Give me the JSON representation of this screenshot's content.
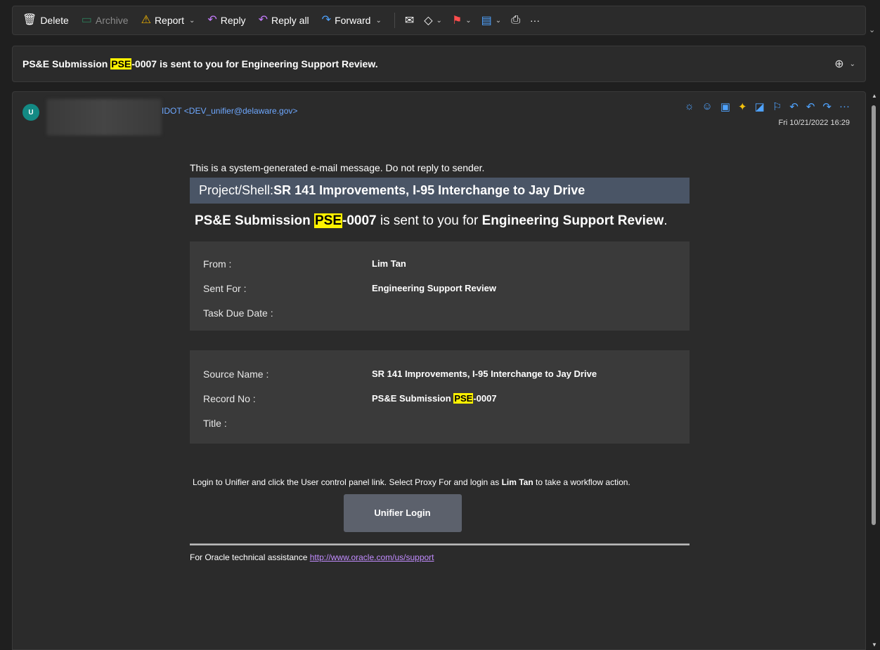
{
  "toolbar": {
    "delete": "Delete",
    "archive": "Archive",
    "report": "Report",
    "reply": "Reply",
    "reply_all": "Reply all",
    "forward": "Forward",
    "more": "···"
  },
  "subject": {
    "prefix": "PS&E Submission ",
    "highlight": "PSE",
    "suffix": "-0007 is sent to you for Engineering Support Review."
  },
  "header": {
    "avatar_initial": "U",
    "sender": "IDOT <DEV_unifier@delaware.gov>",
    "date": "Fri 10/21/2022 16:29"
  },
  "message": {
    "system_note": "This is a system-generated e-mail message. Do not reply to sender.",
    "project_label": "Project/Shell: ",
    "project_name": "SR 141 Improvements, I-95 Interchange to Jay Drive",
    "headline": {
      "p1": "PS&E Submission ",
      "hl": "PSE",
      "p2": "-0007",
      "p3": " is sent to you for ",
      "p4": "Engineering Support Review",
      "p5": "."
    },
    "box1": {
      "from_label": "From :",
      "from_value": "Lim Tan",
      "sentfor_label": "Sent For :",
      "sentfor_value": "Engineering Support Review",
      "due_label": "Task Due Date :",
      "due_value": ""
    },
    "box2": {
      "source_label": "Source Name :",
      "source_value": "SR 141 Improvements, I-95 Interchange to Jay Drive",
      "record_label": "Record No :",
      "record_p1": "PS&E Submission ",
      "record_hl": "PSE",
      "record_p2": "-0007",
      "title_label": "Title :",
      "title_value": ""
    },
    "login": {
      "text1": "Login to Unifier and click the User control panel link. Select Proxy For and login as ",
      "name": "Lim Tan",
      "text2": " to take a workflow action.",
      "button": "Unifier Login"
    },
    "support": {
      "text": "For Oracle technical assistance ",
      "link": "http://www.oracle.com/us/support"
    }
  },
  "colors": {
    "highlight": "#fff200",
    "project_bar": "#4a5566",
    "link": "#c28cff",
    "accent": "#4fa3ff"
  }
}
